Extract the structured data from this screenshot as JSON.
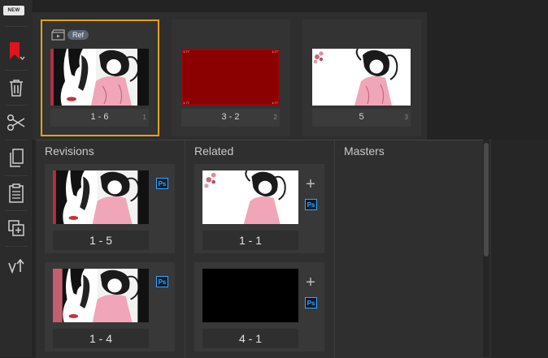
{
  "toolbar": {
    "new_badge": "NEW",
    "tools": [
      "bookmark-icon",
      "trash-icon",
      "scissors-icon",
      "copy-icon",
      "clipboard-icon",
      "duplicate-icon",
      "version-up-icon"
    ]
  },
  "strip": {
    "cards": [
      {
        "name": "1 - 6",
        "index": "1",
        "ref_label": "Ref",
        "selected": true,
        "thumb": "bw-pink-collage"
      },
      {
        "name": "3 - 2",
        "index": "2",
        "selected": false,
        "thumb": "solid-red"
      },
      {
        "name": "5",
        "index": "3",
        "selected": false,
        "thumb": "white-figure"
      }
    ],
    "red_thumb_marker": "1:77"
  },
  "panel": {
    "revisions": {
      "title": "Revisions",
      "items": [
        {
          "name": "1 - 5",
          "badge": "Ps",
          "thumb": "bw-pink-collage"
        },
        {
          "name": "1 - 4",
          "badge": "Ps",
          "thumb": "bw-pink-collage"
        }
      ]
    },
    "related": {
      "title": "Related",
      "items": [
        {
          "name": "1 - 1",
          "badge": "Ps",
          "thumb": "white-figure"
        },
        {
          "name": "4 - 1",
          "badge": "Ps",
          "thumb": "black"
        }
      ]
    },
    "masters": {
      "title": "Masters"
    }
  },
  "colors": {
    "selection": "#e3a21a",
    "ps_accent": "#31a8ff",
    "red_frame": "#8b0000"
  }
}
